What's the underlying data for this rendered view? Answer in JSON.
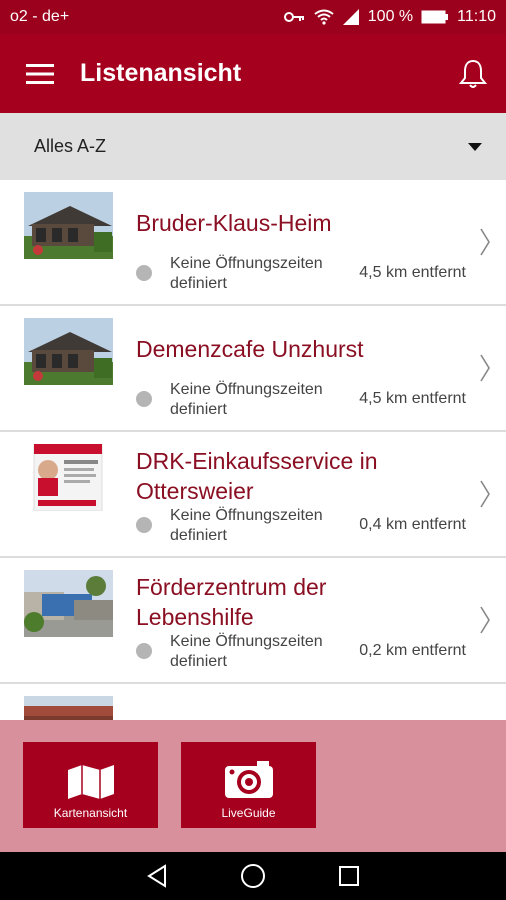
{
  "statusbar": {
    "carrier": "o2 - de+",
    "battery": "100 %",
    "time": "11:10"
  },
  "appbar": {
    "title": "Listenansicht"
  },
  "filter": {
    "selected": "Alles A-Z"
  },
  "items": [
    {
      "name_line1": "Bruder-Klaus-Heim",
      "name_line2": "",
      "hours_line1": "Keine Öffnungszeiten",
      "hours_line2": "definiert",
      "distance": "4,5 km entfernt"
    },
    {
      "name_line1": "Demenzcafe Unzhurst",
      "name_line2": "",
      "hours_line1": "Keine Öffnungszeiten",
      "hours_line2": "definiert",
      "distance": "4,5 km entfernt"
    },
    {
      "name_line1": "DRK-Einkaufsservice in",
      "name_line2": "Ottersweier",
      "hours_line1": "Keine Öffnungszeiten",
      "hours_line2": "definiert",
      "distance": "0,4 km entfernt"
    },
    {
      "name_line1": "Förderzentrum der",
      "name_line2": "Lebenshilfe",
      "hours_line1": "Keine Öffnungszeiten",
      "hours_line2": "definiert",
      "distance": "0,2 km entfernt"
    }
  ],
  "bottom": {
    "map_label": "Kartenansicht",
    "live_label": "LiveGuide"
  },
  "colors": {
    "primary": "#a6001f",
    "status": "#9b001d",
    "panel": "#d7909c",
    "title_text": "#8b0f23"
  }
}
